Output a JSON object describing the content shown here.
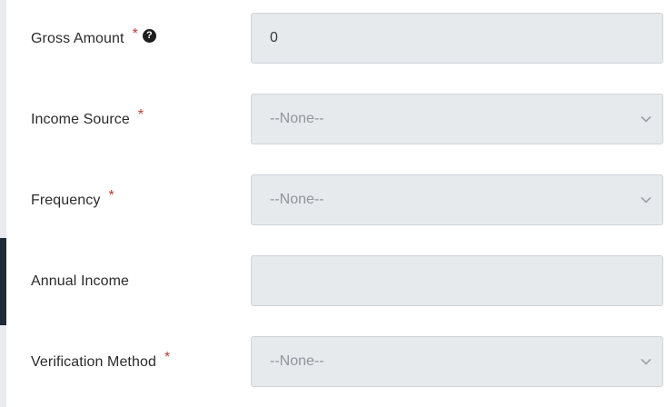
{
  "form": {
    "gross_amount": {
      "label": "Gross Amount",
      "required_marker": "*",
      "help_icon": "question-circle-icon",
      "value": "0"
    },
    "income_source": {
      "label": "Income Source",
      "required_marker": "*",
      "selected": "--None--"
    },
    "frequency": {
      "label": "Frequency",
      "required_marker": "*",
      "selected": "--None--"
    },
    "annual_income": {
      "label": "Annual Income",
      "value": ""
    },
    "verification_method": {
      "label": "Verification Method",
      "required_marker": "*",
      "selected": "--None--"
    }
  },
  "colors": {
    "required": "#c23934",
    "field_background": "#e7eaed",
    "field_border": "#cfd4d9",
    "label_text": "#2b2b2b",
    "placeholder_text": "#8f969c"
  }
}
